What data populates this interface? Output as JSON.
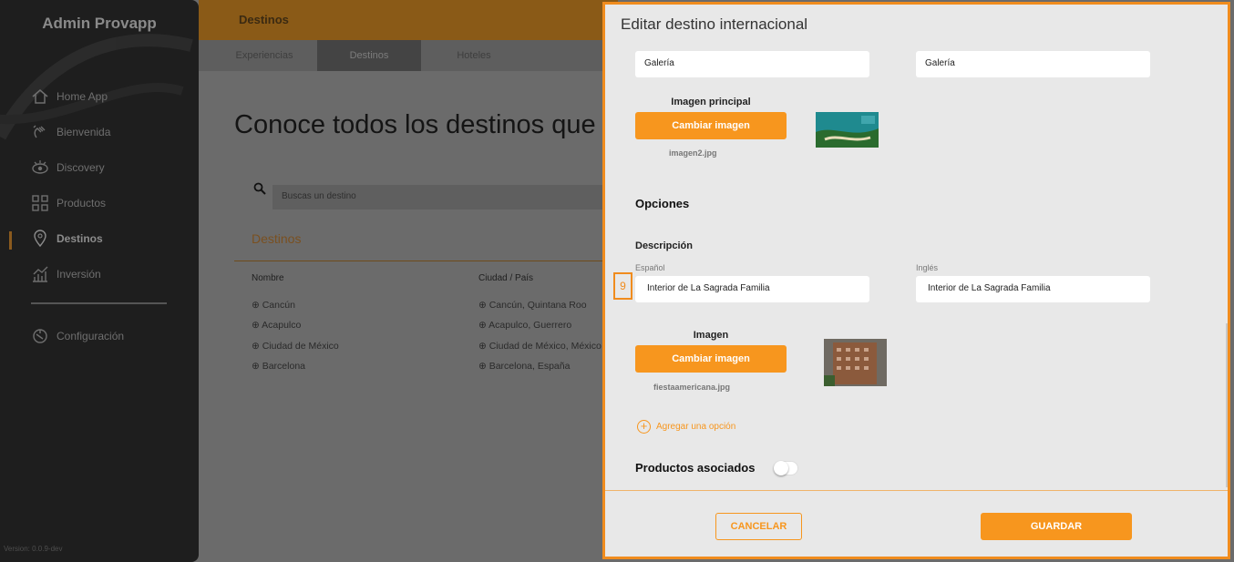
{
  "sidebar": {
    "title": "Admin Provapp",
    "items": [
      {
        "label": "Home App",
        "icon": "home-icon"
      },
      {
        "label": "Bienvenida",
        "icon": "hand-wave-icon"
      },
      {
        "label": "Discovery",
        "icon": "eye-icon"
      },
      {
        "label": "Productos",
        "icon": "grid-icon"
      },
      {
        "label": "Destinos",
        "icon": "location-pin-icon",
        "active": true
      },
      {
        "label": "Inversión",
        "icon": "chart-growth-icon"
      }
    ],
    "config_label": "Configuración",
    "config_icon": "gear-icon",
    "version": "Version: 0.0.9-dev"
  },
  "background": {
    "topbar_title": "Destinos",
    "tabs": [
      {
        "label": "Experiencias"
      },
      {
        "label": "Destinos",
        "active": true
      },
      {
        "label": "Hoteles"
      }
    ],
    "page_title": "Conoce todos los destinos que",
    "search_placeholder": "Buscas un destino",
    "section_label": "Destinos",
    "columns": [
      "Nombre",
      "Ciudad / País"
    ],
    "rows": [
      [
        "Cancún",
        "Cancún, Quintana Roo"
      ],
      [
        "Acapulco",
        "Acapulco, Guerrero"
      ],
      [
        "Ciudad de México",
        "Ciudad de México, México"
      ],
      [
        "Barcelona",
        "Barcelona, España"
      ]
    ]
  },
  "modal": {
    "title": "Editar destino internacional",
    "galeria_es": "Galería",
    "galeria_en": "Galería",
    "main_image_label": "Imagen principal",
    "change_image_label": "Cambiar imagen",
    "main_image_file": "imagen2.jpg",
    "options_title": "Opciones",
    "option_number": "9",
    "description_label": "Descripción",
    "spanish_label": "Español",
    "english_label": "Inglés",
    "description_es": "Interior de La Sagrada Familia",
    "description_en": "Interior de La Sagrada Familia",
    "image_label": "Imagen",
    "change_image_label_2": "Cambiar imagen",
    "image_file": "fiestaamericana.jpg",
    "add_option_label": "Agregar una opción",
    "associated_products_label": "Productos asociados",
    "associated_products_enabled": false,
    "cancel_label": "CANCELAR",
    "save_label": "GUARDAR"
  },
  "colors": {
    "accent": "#f7961e",
    "modal_border": "#f08c1e",
    "sidebar_bg": "#1e1e1e"
  }
}
